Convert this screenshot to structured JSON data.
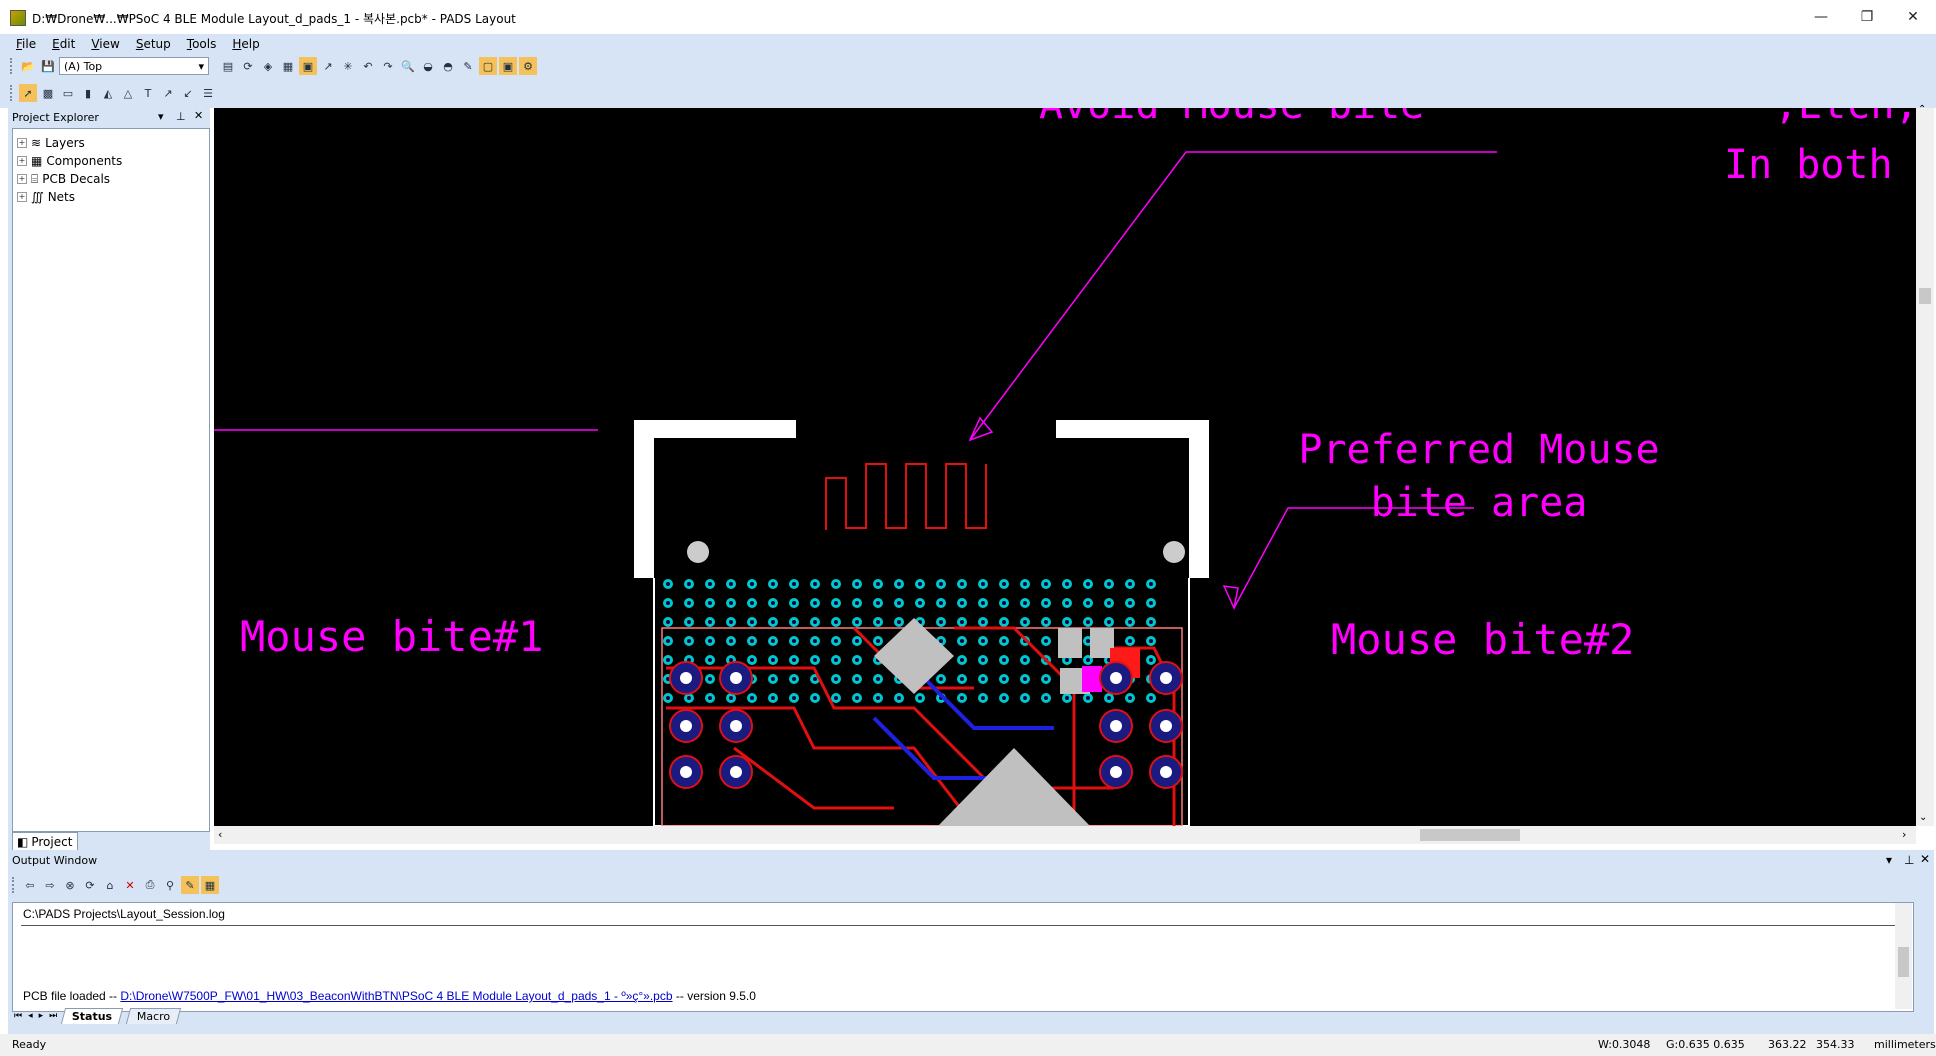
{
  "window": {
    "title": "D:₩Drone₩...₩PSoC 4 BLE Module Layout_d_pads_1 - 복사본.pcb* - PADS Layout",
    "minimize": "—",
    "restore": "❐",
    "close": "✕"
  },
  "menu": [
    "File",
    "Edit",
    "View",
    "Setup",
    "Tools",
    "Help"
  ],
  "toolbar": {
    "layer_value": "(A) Top"
  },
  "project_explorer": {
    "title": "Project Explorer",
    "items": [
      {
        "label": "Layers"
      },
      {
        "label": "Components"
      },
      {
        "label": "PCB Decals"
      },
      {
        "label": "Nets"
      }
    ],
    "tab_label": "Project"
  },
  "canvas": {
    "annotations": {
      "avoid": "Avoid Mouse bite",
      "etch": ",Etch,L",
      "inboth": "In both",
      "preferred_line1": "Preferred Mouse",
      "preferred_line2": "bite area",
      "mb1": "Mouse bite#1",
      "mb2": "Mouse bite#2"
    },
    "colors": {
      "background": "#000000",
      "annotation": "#ff00ff",
      "board_outline": "#ffffff",
      "via": "#00c8c8",
      "trace_red": "#e01010",
      "pad_blue": "#1a1a80"
    }
  },
  "output_window": {
    "title": "Output Window",
    "log_path": "C:\\PADS Projects\\Layout_Session.log",
    "loaded_prefix": "PCB file loaded -- ",
    "loaded_link": "D:\\Drone\\W7500P_FW\\01_HW\\03_BeaconWithBTN\\PSoC 4 BLE Module Layout_d_pads_1 - º»ç°».pcb",
    "loaded_suffix": " -- version 9.5.0",
    "tabs": [
      "Status",
      "Macro"
    ]
  },
  "statusbar": {
    "state": "Ready",
    "width": "W:0.3048",
    "grid": "G:0.635 0.635",
    "x": "363.22",
    "y": "354.33",
    "units": "millimeters"
  }
}
